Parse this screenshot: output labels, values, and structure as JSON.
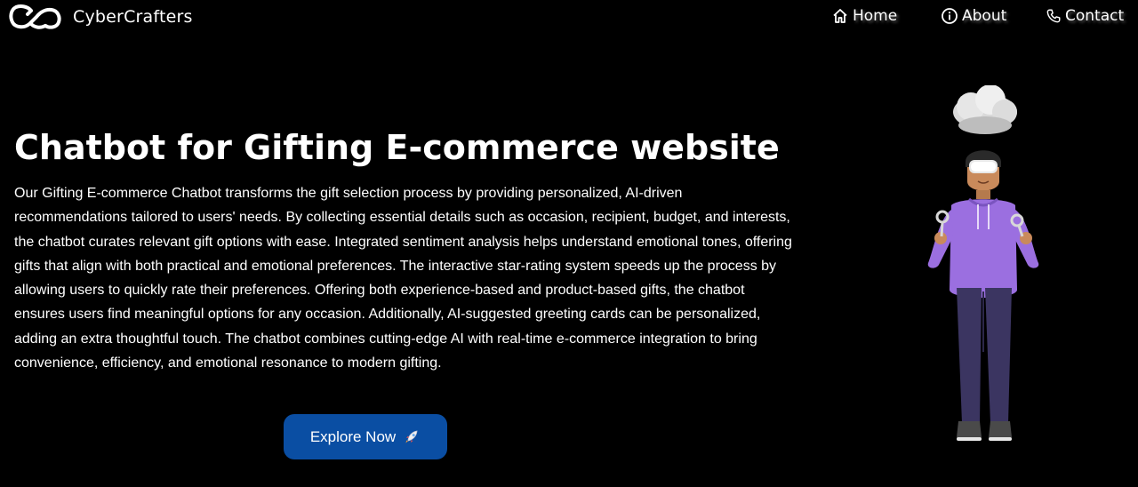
{
  "brand": {
    "name": "CyberCrafters",
    "logo_icon": "cc-infinity-logo"
  },
  "nav": {
    "items": [
      {
        "label": "Home",
        "icon": "home-icon"
      },
      {
        "label": "About",
        "icon": "info-icon"
      },
      {
        "label": "Contact",
        "icon": "phone-icon"
      }
    ]
  },
  "hero": {
    "title": "Chatbot for Gifting E-commerce website",
    "description": "Our Gifting E-commerce Chatbot transforms the gift selection process by providing personalized, AI-driven recommendations tailored to users' needs. By collecting essential details such as occasion, recipient, budget, and interests, the chatbot curates relevant gift options with ease. Integrated sentiment analysis helps understand emotional tones, offering gifts that align with both practical and emotional preferences. The interactive star-rating system speeds up the process by allowing users to quickly rate their preferences. Offering both experience-based and product-based gifts, the chatbot ensures users find meaningful options for any occasion. Additionally, AI-suggested greeting cards can be personalized, adding an extra thoughtful touch. The chatbot combines cutting-edge AI with real-time e-commerce integration to bring convenience, efficiency, and emotional resonance to modern gifting.",
    "cta_label": "Explore Now",
    "cta_icon": "rocket-icon"
  },
  "illustration": {
    "subject": "3d-character-vr-headset-cloud"
  },
  "colors": {
    "background": "#000000",
    "text": "#ffffff",
    "button": "#0a4ea3",
    "hoodie": "#9b6fe0",
    "pants": "#3b3561"
  }
}
